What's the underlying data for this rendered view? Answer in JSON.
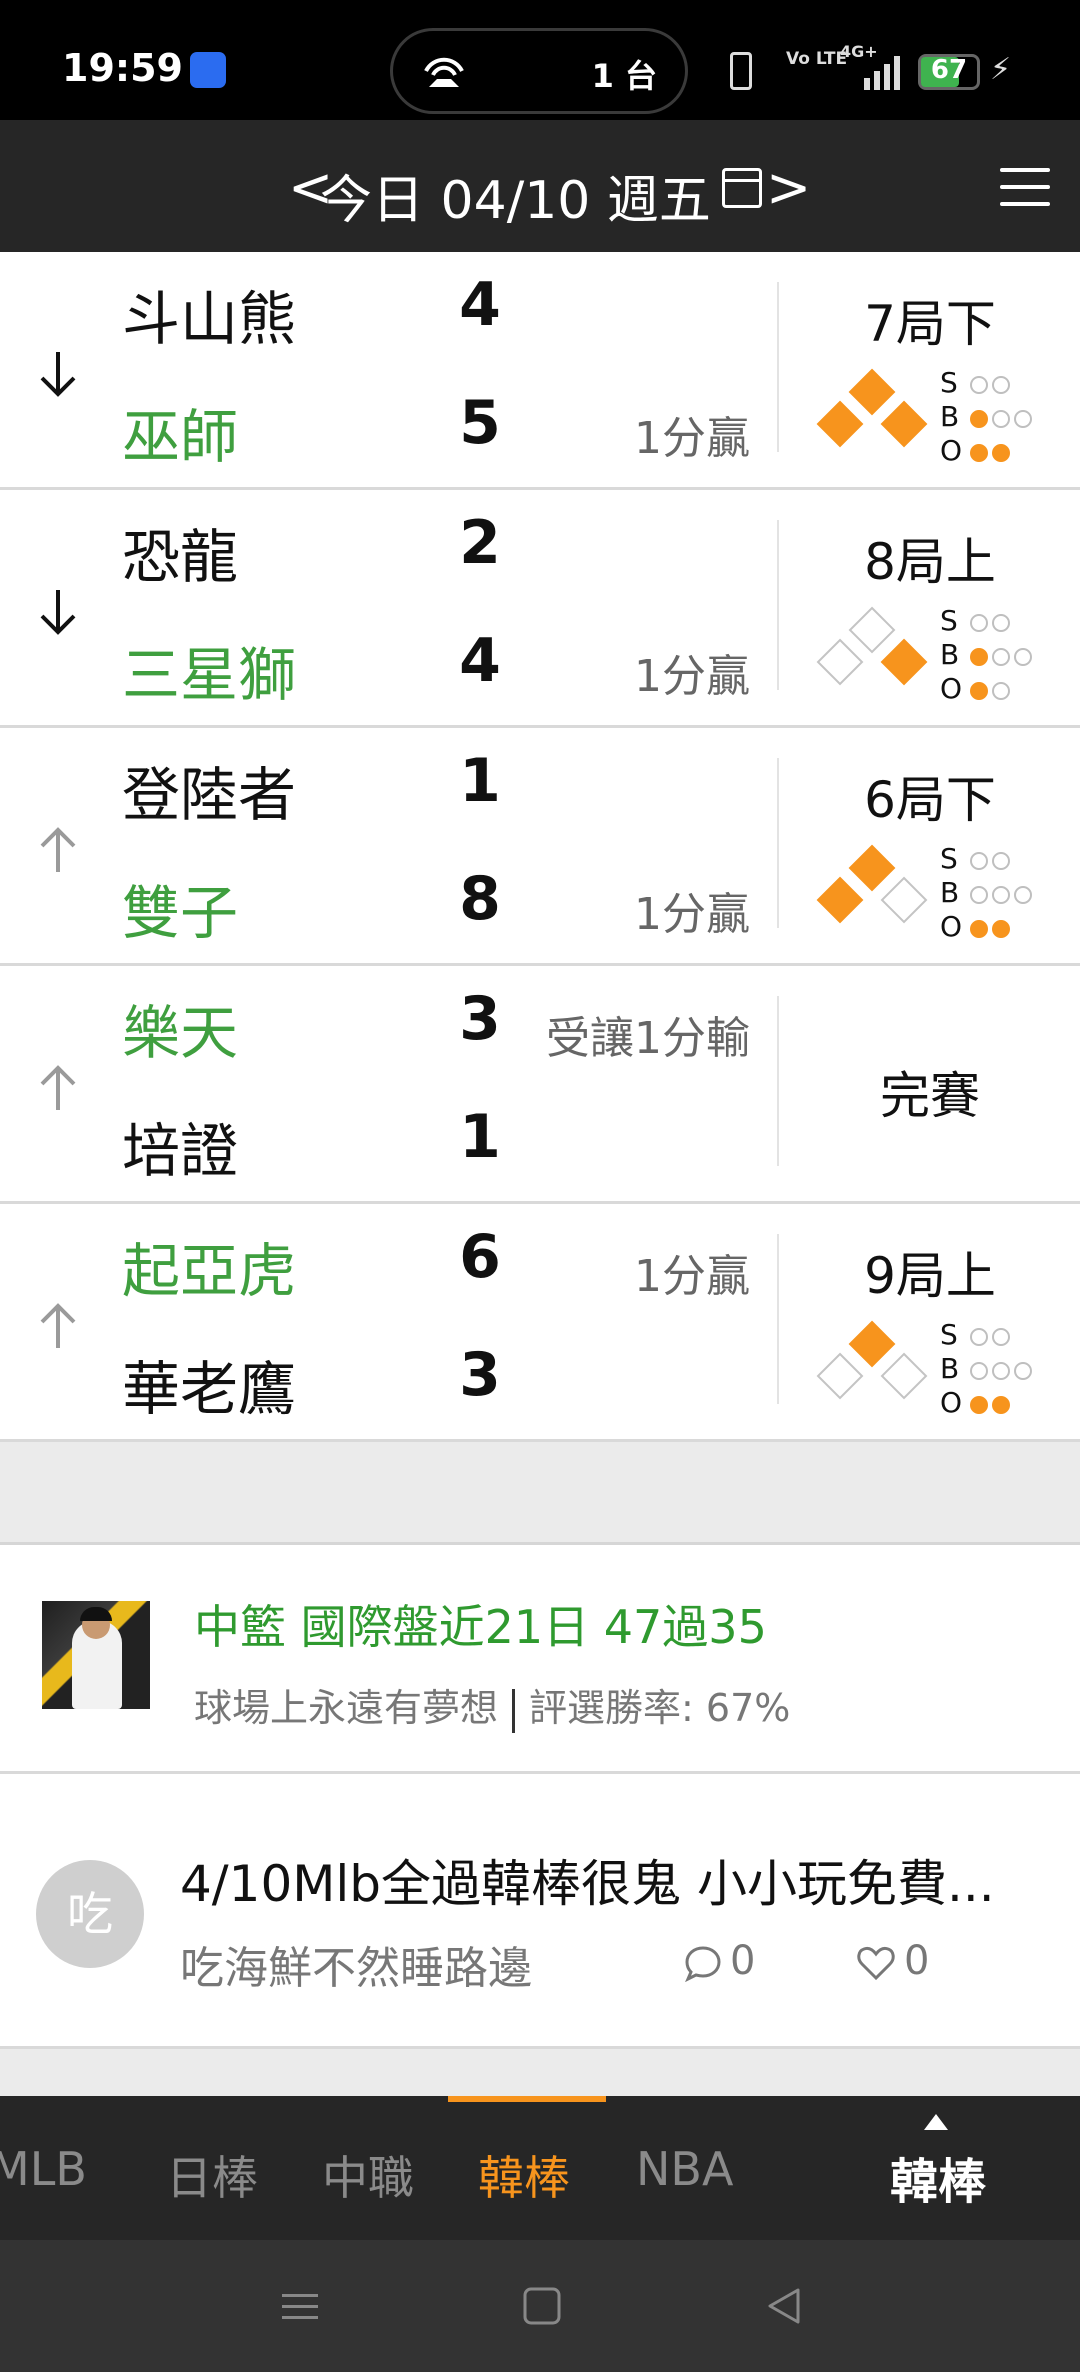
{
  "status_bar": {
    "time": "19:59",
    "hotspot_count": "1 台",
    "volte": "Vo LTE",
    "network": "4G+",
    "battery": "67",
    "battery_level": 0.67
  },
  "header": {
    "prev": "<",
    "title": "今日 04/10 週五",
    "next": ">"
  },
  "games": [
    {
      "trend": "down",
      "team1": {
        "name": "斗山熊",
        "score": "4",
        "color": "black"
      },
      "team2": {
        "name": "巫師",
        "score": "5",
        "color": "green"
      },
      "note": "1分贏",
      "note_row": 2,
      "status": "7局下",
      "bases": {
        "first": true,
        "second": true,
        "third": true
      },
      "sbo": {
        "s": 0,
        "b": 1,
        "o": 2
      }
    },
    {
      "trend": "down",
      "team1": {
        "name": "恐龍",
        "score": "2",
        "color": "black"
      },
      "team2": {
        "name": "三星獅",
        "score": "4",
        "color": "green"
      },
      "note": "1分贏",
      "note_row": 2,
      "status": "8局上",
      "bases": {
        "first": true,
        "second": false,
        "third": false
      },
      "sbo": {
        "s": 0,
        "b": 1,
        "o": 1
      }
    },
    {
      "trend": "up",
      "team1": {
        "name": "登陸者",
        "score": "1",
        "color": "black"
      },
      "team2": {
        "name": "雙子",
        "score": "8",
        "color": "green"
      },
      "note": "1分贏",
      "note_row": 2,
      "status": "6局下",
      "bases": {
        "first": false,
        "second": true,
        "third": true
      },
      "sbo": {
        "s": 0,
        "b": 0,
        "o": 2
      }
    },
    {
      "trend": "up",
      "team1": {
        "name": "樂天",
        "score": "3",
        "color": "green"
      },
      "team2": {
        "name": "培證",
        "score": "1",
        "color": "black"
      },
      "note": "受讓1分輸",
      "note_row": 1,
      "status": "完賽",
      "final": true
    },
    {
      "trend": "up",
      "team1": {
        "name": "起亞虎",
        "score": "6",
        "color": "green"
      },
      "team2": {
        "name": "華老鷹",
        "score": "3",
        "color": "black"
      },
      "note": "1分贏",
      "note_row": 1,
      "status": "9局上",
      "bases": {
        "first": false,
        "second": true,
        "third": false
      },
      "sbo": {
        "s": 0,
        "b": 0,
        "o": 2
      }
    }
  ],
  "sbo_labels": {
    "s": "S",
    "b": "B",
    "o": "O"
  },
  "tipster": {
    "title": "中籃 國際盤近21日 47過35",
    "name": "球場上永遠有夢想",
    "win_rate": "評選勝率: 67%"
  },
  "post": {
    "avatar_text": "吃",
    "title": "4/10Mlb全過韓棒很鬼 小小玩免費...",
    "author": "吃海鮮不然睡路邊",
    "comments": "0",
    "likes": "0"
  },
  "tabs": [
    "MLB",
    "日棒",
    "中職",
    "韓棒",
    "NBA"
  ],
  "active_tab": "韓棒",
  "current_league": "韓棒",
  "colors": {
    "accent": "#f7941d",
    "win_green": "#3f9f3f",
    "header_bg": "#262626"
  }
}
